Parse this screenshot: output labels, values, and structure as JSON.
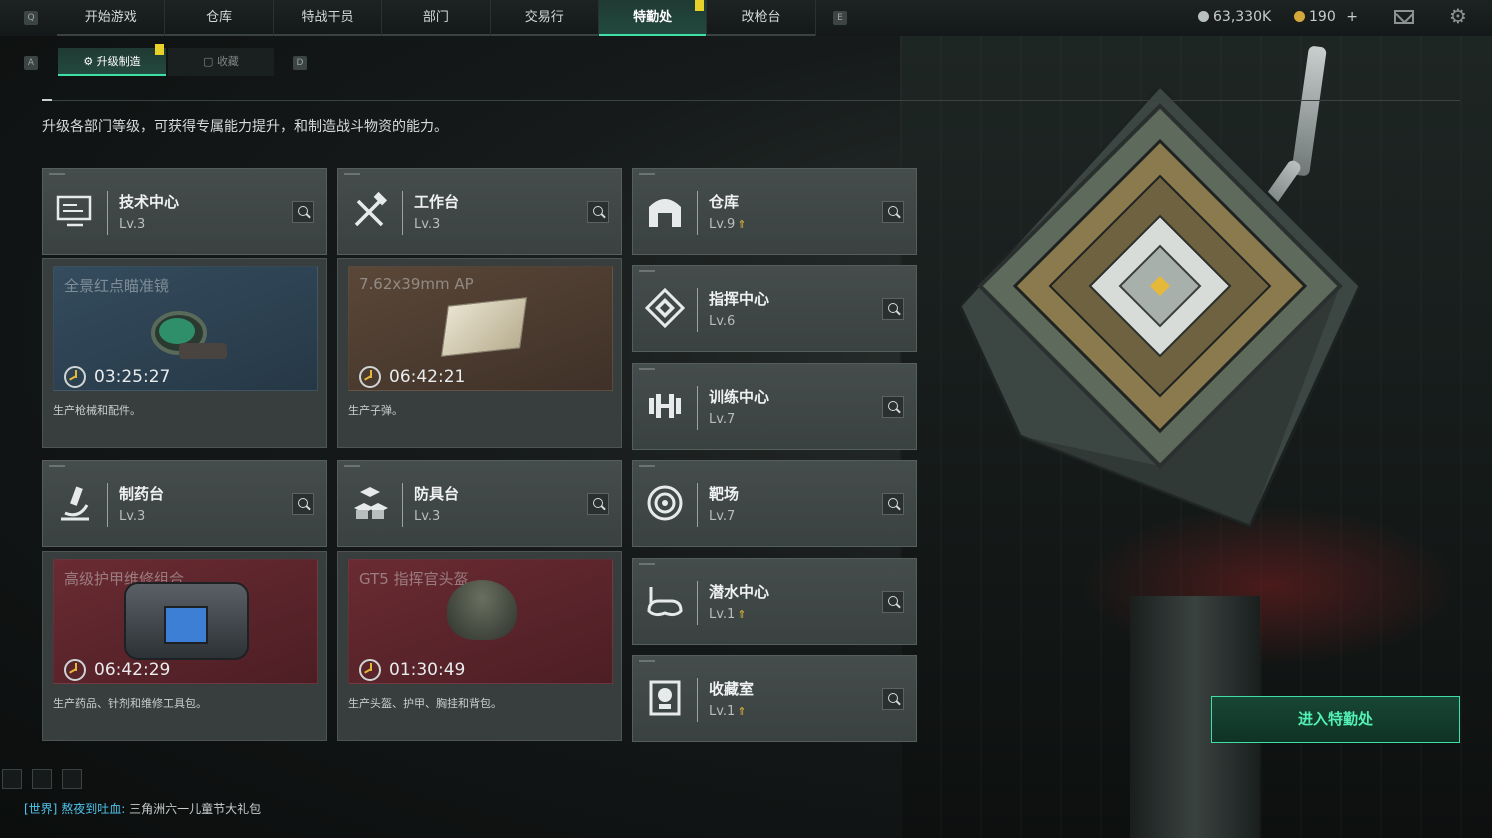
{
  "topbar": {
    "keys": {
      "left": "Q",
      "right": "E"
    },
    "tabs": [
      "开始游戏",
      "仓库",
      "特战干员",
      "部门",
      "交易行",
      "特勤处",
      "改枪台"
    ],
    "active_tab": "特勤处",
    "currency_silver": "63,330K",
    "currency_gold": "190",
    "plus": "+",
    "accent": "#3fe0a5"
  },
  "subtabs": {
    "key_left": "A",
    "key_right": "D",
    "active": "升级制造",
    "other": "收藏"
  },
  "description": "升级各部门等级，可获得专属能力提升，和制造战斗物资的能力。",
  "departments": [
    {
      "name": "技术中心",
      "level": "Lv.3",
      "upgrade": false,
      "icon": "monitor-icon"
    },
    {
      "name": "工作台",
      "level": "Lv.3",
      "upgrade": false,
      "icon": "tools-icon"
    },
    {
      "name": "仓库",
      "level": "Lv.9",
      "upgrade": true,
      "icon": "warehouse-icon"
    },
    {
      "name": "指挥中心",
      "level": "Lv.6",
      "upgrade": false,
      "icon": "command-icon"
    },
    {
      "name": "训练中心",
      "level": "Lv.7",
      "upgrade": false,
      "icon": "dumbbell-icon"
    },
    {
      "name": "制药台",
      "level": "Lv.3",
      "upgrade": false,
      "icon": "microscope-icon"
    },
    {
      "name": "防具台",
      "level": "Lv.3",
      "upgrade": false,
      "icon": "blocks-icon"
    },
    {
      "name": "靶场",
      "level": "Lv.7",
      "upgrade": false,
      "icon": "target-icon"
    },
    {
      "name": "潜水中心",
      "level": "Lv.1",
      "upgrade": true,
      "icon": "goggles-icon"
    },
    {
      "name": "收藏室",
      "level": "Lv.1",
      "upgrade": true,
      "icon": "vault-icon"
    }
  ],
  "productions": [
    {
      "item": "全景红点瞄准镜",
      "timer": "03:25:27",
      "caption": "生产枪械和配件。",
      "tone": "blue"
    },
    {
      "item": "7.62x39mm AP",
      "timer": "06:42:21",
      "caption": "生产子弹。",
      "tone": "brown"
    },
    {
      "item": "高级护甲维修组合",
      "timer": "06:42:29",
      "caption": "生产药品、针剂和维修工具包。",
      "tone": "red"
    },
    {
      "item": "GT5 指挥官头盔",
      "timer": "01:30:49",
      "caption": "生产头盔、护甲、胸挂和背包。",
      "tone": "red"
    }
  ],
  "enter_button": "进入特勤处",
  "chat": {
    "channel": "[世界]",
    "user": "熬夜到吐血:",
    "message": "三角洲六一儿童节大礼包"
  }
}
